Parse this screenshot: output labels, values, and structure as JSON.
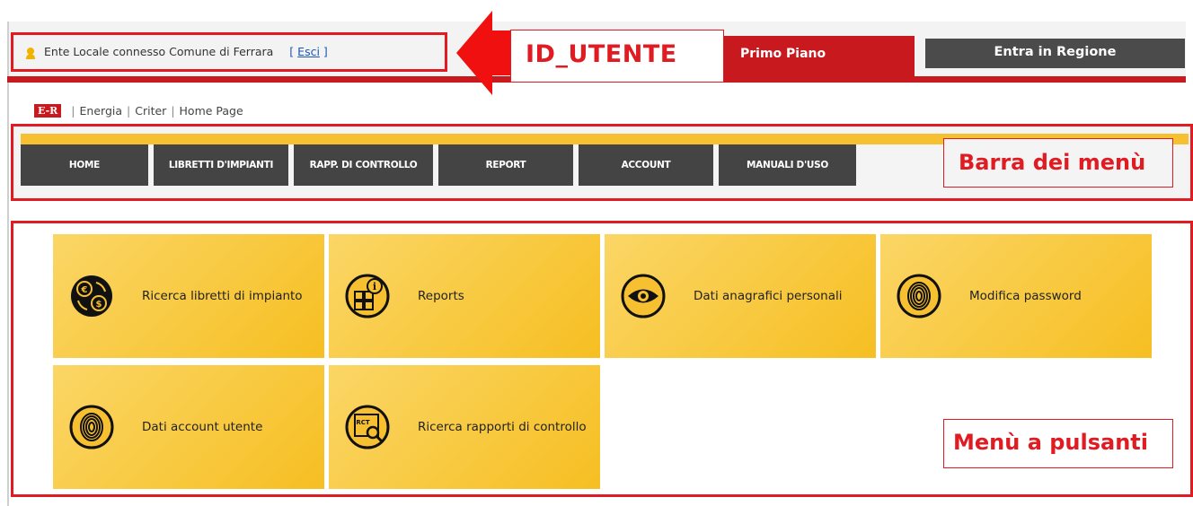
{
  "header": {
    "user_status": "Ente Locale connesso Comune di Ferrara",
    "logout_open": "[",
    "logout_label": "Esci",
    "logout_close": "]",
    "annotation_id": "ID_UTENTE",
    "primo_piano": "Primo Piano",
    "entra_regione": "Entra in Regione"
  },
  "breadcrumb": {
    "logo": "E-R",
    "items": [
      "Energia",
      "Criter",
      "Home Page"
    ]
  },
  "menu": {
    "items": [
      "HOME",
      "LIBRETTI D'IMPIANTI",
      "RAPP. DI CONTROLLO",
      "REPORT",
      "ACCOUNT",
      "MANUALI D'USO"
    ],
    "annotation": "Barra dei menù"
  },
  "tiles": {
    "items": [
      {
        "label": "Ricerca libretti di impianto",
        "icon": "euro-dollar-exchange-icon"
      },
      {
        "label": "Reports",
        "icon": "report-info-icon"
      },
      {
        "label": "Dati anagrafici personali",
        "icon": "eye-icon"
      },
      {
        "label": "Modifica password",
        "icon": "fingerprint-icon"
      },
      {
        "label": "Dati account utente",
        "icon": "fingerprint-icon"
      },
      {
        "label": "Ricerca rapporti di controllo",
        "icon": "rct-search-icon"
      }
    ],
    "annotation": "Menù a pulsanti"
  },
  "colors": {
    "red": "#c8191e",
    "annotation_red": "#e01b22",
    "yellow": "#f7c030",
    "dark_gray": "#444444"
  }
}
